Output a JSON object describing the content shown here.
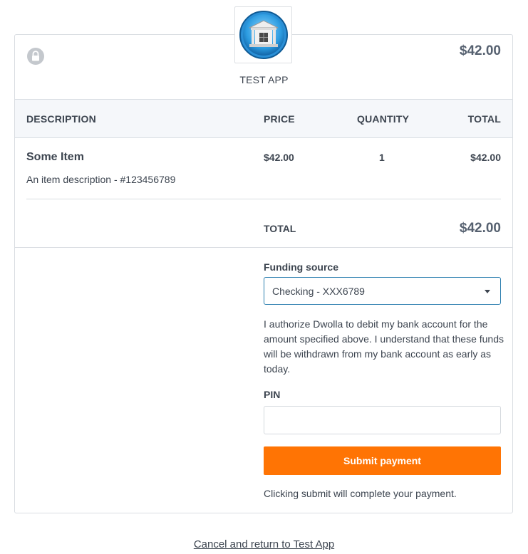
{
  "app": {
    "name": "TEST APP",
    "logo_icon": "bank-building-icon"
  },
  "header": {
    "amount": "$42.00",
    "lock_icon": "lock-icon"
  },
  "table": {
    "columns": [
      "DESCRIPTION",
      "PRICE",
      "QUANTITY",
      "TOTAL"
    ],
    "items": [
      {
        "name": "Some Item",
        "description": "An item description - #123456789",
        "price": "$42.00",
        "quantity": "1",
        "total": "$42.00"
      }
    ],
    "total_label": "TOTAL",
    "total_amount": "$42.00"
  },
  "funding": {
    "label": "Funding source",
    "selected": "Checking - XXX6789",
    "authorization": "I authorize Dwolla to debit my bank account for the amount specified above. I understand that these funds will be withdrawn from my bank account as early as today."
  },
  "pin": {
    "label": "PIN",
    "value": "",
    "placeholder": ""
  },
  "submit": {
    "label": "Submit payment",
    "note": "Clicking submit will complete your payment.",
    "color": "#ff7404"
  },
  "cancel": {
    "label": "Cancel and return to Test App"
  }
}
